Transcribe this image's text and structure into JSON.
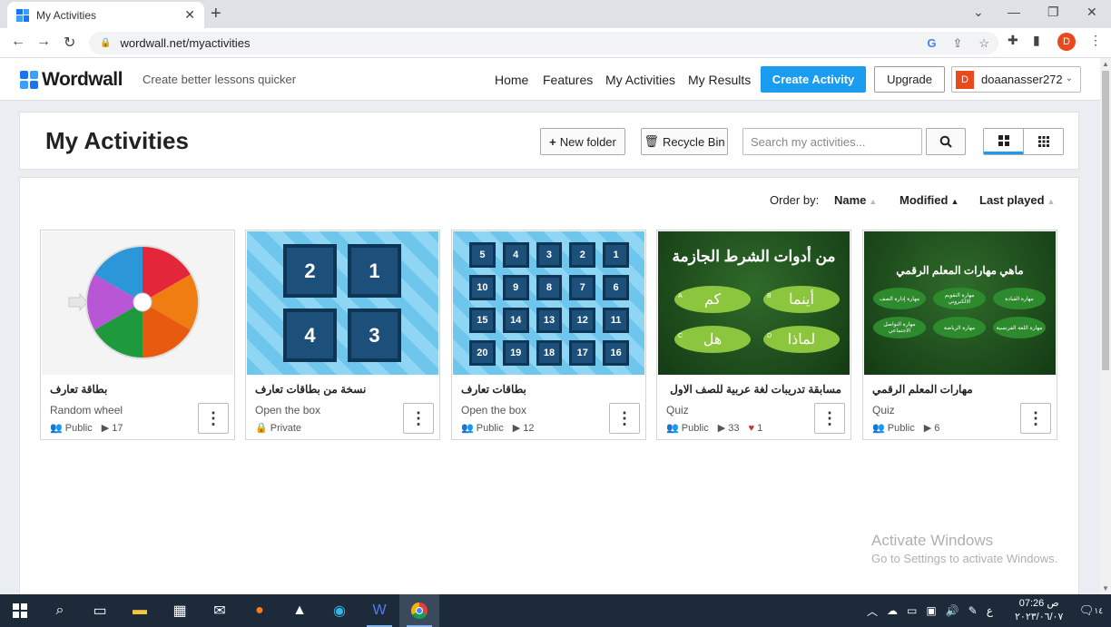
{
  "browser": {
    "tab_title": "My Activities",
    "tab_close": "✕",
    "new_tab": "+",
    "url": "wordwall.net/myactivities",
    "profile_letter": "D",
    "window_controls": [
      "⌄",
      "—",
      "❐",
      "✕"
    ]
  },
  "site": {
    "logo": "Wordwall",
    "tagline": "Create better lessons quicker",
    "nav": [
      "Home",
      "Features",
      "My Activities",
      "My Results"
    ],
    "create_label": "Create Activity",
    "upgrade_label": "Upgrade",
    "user": "doaanasser272",
    "user_initial": "D",
    "accent": "#1a9cf0"
  },
  "toolbar": {
    "title": "My Activities",
    "new_folder": "New folder",
    "recycle_bin": "Recycle Bin",
    "search_placeholder": "Search my activities..."
  },
  "sort": {
    "label": "Order by:",
    "options": [
      {
        "label": "Name",
        "active": false
      },
      {
        "label": "Modified",
        "active": true
      },
      {
        "label": "Last played",
        "active": false
      }
    ]
  },
  "activities": [
    {
      "title": "بطاقة تعارف",
      "type": "Random wheel",
      "visibility": "Public",
      "plays": "17",
      "likes": ""
    },
    {
      "title": "نسخة من بطاقات تعارف",
      "type": "Open the box",
      "visibility": "Private",
      "plays": "",
      "likes": ""
    },
    {
      "title": "بطاقات تعارف",
      "type": "Open the box",
      "visibility": "Public",
      "plays": "12",
      "likes": ""
    },
    {
      "title": "مسابقة تدريبات لغة عربية للصف الاول الاعدا",
      "type": "Quiz",
      "visibility": "Public",
      "plays": "33",
      "likes": "1"
    },
    {
      "title": "مهارات المعلم الرقمي",
      "type": "Quiz",
      "visibility": "Public",
      "plays": "6",
      "likes": ""
    }
  ],
  "thumb_text": {
    "box_small": [
      "5",
      "4",
      "3",
      "2",
      "1",
      "10",
      "9",
      "8",
      "7",
      "6",
      "15",
      "14",
      "13",
      "12",
      "11",
      "20",
      "19",
      "18",
      "17",
      "16"
    ],
    "box_large": [
      "2",
      "1",
      "4",
      "3"
    ],
    "quiz1_heading": "من أدوات الشرط الجازمة",
    "quiz1_answers": [
      "كم",
      "أينما",
      "هل",
      "لماذا"
    ],
    "quiz1_letters": [
      "A",
      "B",
      "C",
      "D"
    ],
    "quiz2_heading": "ماهي مهارات المعلم الرقمي",
    "quiz2_answers": [
      "مهارة إدارة الصف",
      "مهارة التقويم الالكتروني",
      "مهارة القيادة",
      "مهارة التواصل الاجتماعي",
      "مهارة الرياضة",
      "مهارة اللغة الفرنسية"
    ]
  },
  "watermark": {
    "line1": "Activate Windows",
    "line2": "Go to Settings to activate Windows."
  },
  "taskbar": {
    "time": "07:26 ص",
    "date": "٢٠٢٣/٠٦/٠٧",
    "lang": "ع",
    "notif_count": "١٤"
  }
}
